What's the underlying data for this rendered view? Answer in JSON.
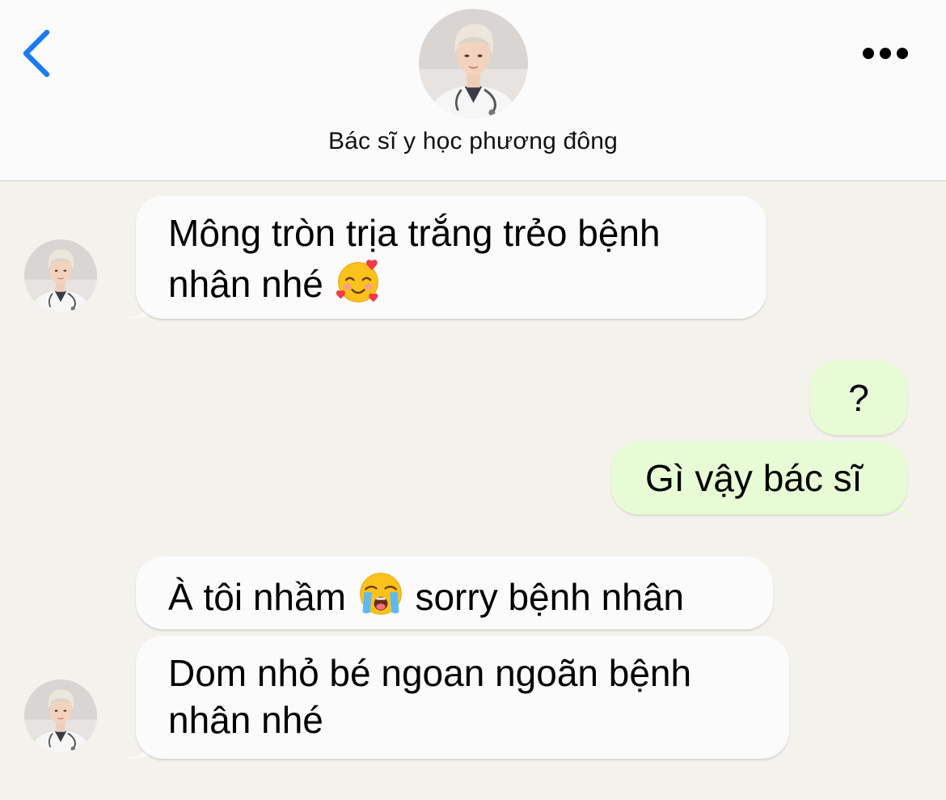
{
  "header": {
    "back_icon": "chevron-left-icon",
    "more_icon": "ellipsis-icon",
    "contact_name": "Bác sĩ y học phương đông",
    "accent_color": "#1a7cf5"
  },
  "messages": [
    {
      "direction": "incoming",
      "line1": "Mông tròn trịa trắng trẻo bệnh",
      "line2": "nhân nhé",
      "emoji": "smiling-face-with-hearts-icon"
    },
    {
      "direction": "outgoing",
      "text": "?"
    },
    {
      "direction": "outgoing",
      "text": "Gì vậy bác sĩ"
    },
    {
      "direction": "incoming",
      "text_before": "À tôi nhầm",
      "emoji": "loudly-crying-face-icon",
      "text_after": "sorry bệnh nhân"
    },
    {
      "direction": "incoming",
      "line1": "Dom nhỏ bé ngoan ngoãn bệnh",
      "line2": "nhân nhé"
    }
  ],
  "colors": {
    "background": "#f4f2ec",
    "header_background": "#fbfbfb",
    "incoming_bubble": "#fbfbfb",
    "outgoing_bubble": "#e7fbd5"
  }
}
